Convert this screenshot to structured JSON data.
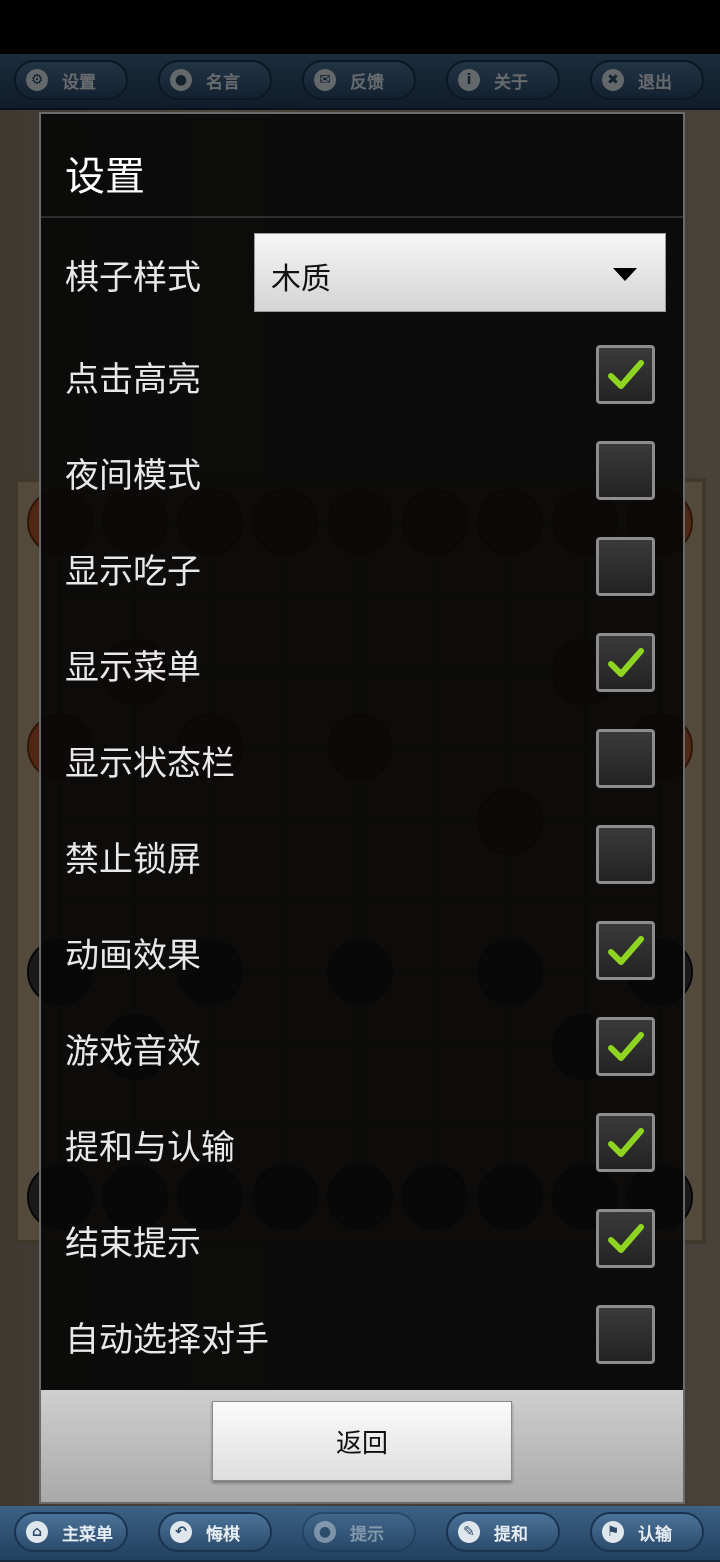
{
  "top_menu": [
    {
      "label": "设置",
      "icon": "gear-icon",
      "glyph": "⚙"
    },
    {
      "label": "名言",
      "icon": "speech-bubble-icon",
      "glyph": "●"
    },
    {
      "label": "反馈",
      "icon": "envelope-icon",
      "glyph": "✉"
    },
    {
      "label": "关于",
      "icon": "info-icon",
      "glyph": "i"
    },
    {
      "label": "退出",
      "icon": "close-icon",
      "glyph": "✖"
    }
  ],
  "bottom_menu": [
    {
      "label": "主菜单",
      "icon": "home-icon",
      "glyph": "⌂",
      "disabled": false
    },
    {
      "label": "悔棋",
      "icon": "undo-icon",
      "glyph": "↶",
      "disabled": false
    },
    {
      "label": "提示",
      "icon": "hint-icon",
      "glyph": "●",
      "disabled": true
    },
    {
      "label": "提和",
      "icon": "pencil-icon",
      "glyph": "✎",
      "disabled": false
    },
    {
      "label": "认输",
      "icon": "flag-icon",
      "glyph": "⚑",
      "disabled": false
    }
  ],
  "dialog": {
    "title": "设置",
    "piece_style": {
      "label": "棋子样式",
      "value": "木质"
    },
    "options": [
      {
        "label": "点击高亮",
        "checked": true
      },
      {
        "label": "夜间模式",
        "checked": false
      },
      {
        "label": "显示吃子",
        "checked": false
      },
      {
        "label": "显示菜单",
        "checked": true
      },
      {
        "label": "显示状态栏",
        "checked": false
      },
      {
        "label": "禁止锁屏",
        "checked": false
      },
      {
        "label": "动画效果",
        "checked": true
      },
      {
        "label": "游戏音效",
        "checked": true
      },
      {
        "label": "提和与认输",
        "checked": true
      },
      {
        "label": "结束提示",
        "checked": true
      },
      {
        "label": "自动选择对手",
        "checked": false
      }
    ],
    "back_label": "返回"
  },
  "colors": {
    "accent_check": "#8fd323",
    "menu_bar": "#2c4b6c"
  }
}
